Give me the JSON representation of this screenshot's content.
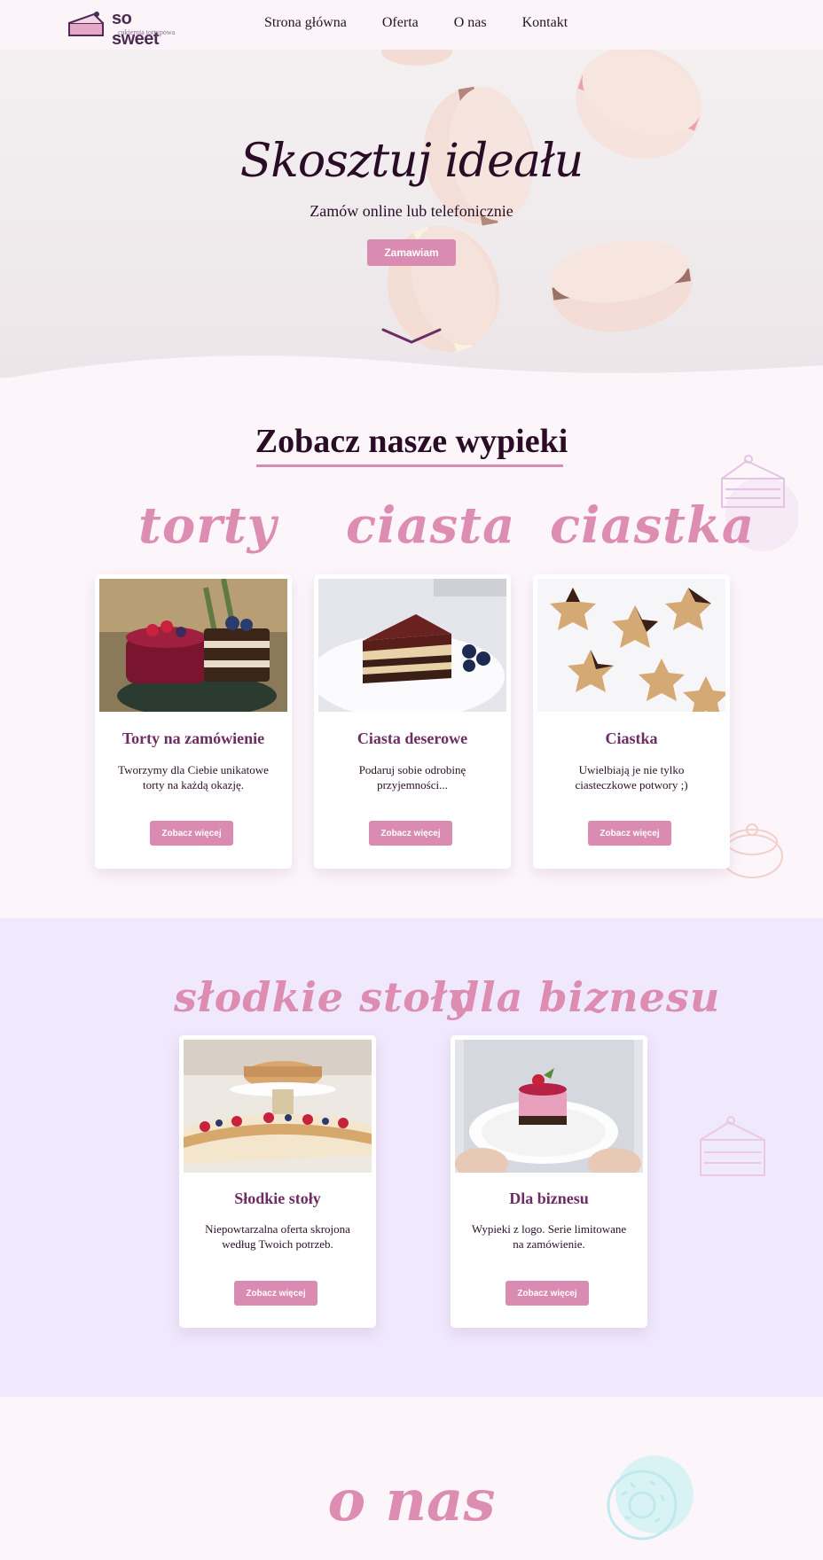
{
  "header": {
    "logo_name": "so sweet",
    "logo_tagline": "cukiernia tortypowa",
    "nav": [
      "Strona główna",
      "Oferta",
      "O nas",
      "Kontakt"
    ]
  },
  "hero": {
    "title": "Skosztuj ideału",
    "subtitle": "Zamów online lub telefonicznie",
    "button": "Zamawiam"
  },
  "offer": {
    "title": "Zobacz nasze wypieki",
    "cards": [
      {
        "script": "torty",
        "title": "Torty na zamówienie",
        "text": "Tworzymy dla Ciebie unikatowe torty na każdą okazję.",
        "button": "Zobacz więcej"
      },
      {
        "script": "ciasta",
        "title": "Ciasta deserowe",
        "text": "Podaruj sobie odrobinę przyjemności...",
        "button": "Zobacz więcej"
      },
      {
        "script": "ciastka",
        "title": "Ciastka",
        "text": "Uwielbiają je nie tylko ciasteczkowe potwory ;)",
        "button": "Zobacz więcej"
      }
    ]
  },
  "extra": {
    "cards": [
      {
        "script": "słodkie stoły",
        "title": "Słodkie stoły",
        "text": "Niepowtarzalna oferta skrojona według Twoich potrzeb.",
        "button": "Zobacz więcej"
      },
      {
        "script": "dla biznesu",
        "title": "Dla biznesu",
        "text": "Wypieki z logo. Serie limitowane na zamówienie.",
        "button": "Zobacz więcej"
      }
    ]
  },
  "about": {
    "script": "o nas"
  },
  "colors": {
    "accent": "#d98bb1",
    "script": "#de8db2",
    "dark": "#2a0c26",
    "card_title": "#6e2b64",
    "lavender": "#f0e8fd"
  }
}
